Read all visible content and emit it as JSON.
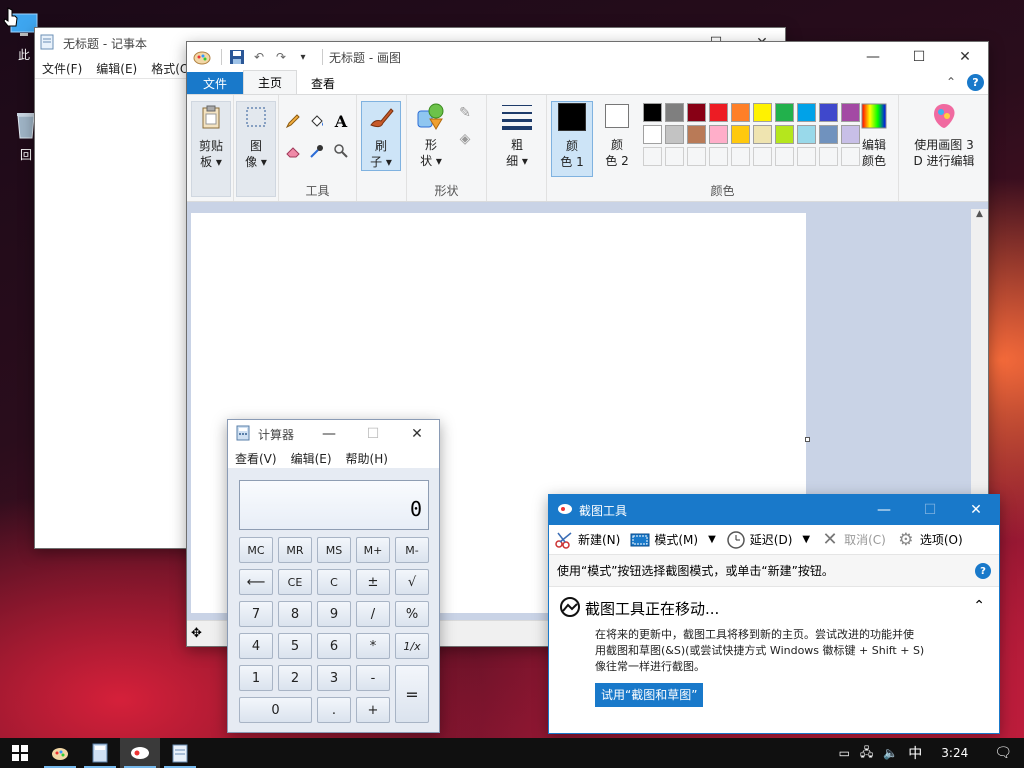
{
  "desktop": {
    "icons": [
      {
        "label": "此"
      },
      {
        "label": "回"
      }
    ]
  },
  "notepad": {
    "title": "无标题 - 记事本",
    "menu": [
      "文件(F)",
      "编辑(E)",
      "格式(O)"
    ]
  },
  "paint": {
    "title": "无标题 - 画图",
    "tabs": {
      "file": "文件",
      "home": "主页",
      "view": "查看"
    },
    "groups": {
      "clipboard": "剪贴板",
      "image": "图像",
      "tools": "工具",
      "brushes": "刷子",
      "shapes": "形状",
      "size": "粗细",
      "color1": "颜色 1",
      "color2": "颜色 2",
      "colors": "颜色",
      "edit_colors": "编辑颜色",
      "paint3d": "使用画图 3D 进行编辑"
    },
    "labels": {
      "clipboard_a": "剪贴",
      "clipboard_b": "板",
      "image_a": "图",
      "image_b": "像",
      "brush_a": "刷",
      "brush_b": "子",
      "shape_a": "形",
      "shape_b": "状",
      "size_a": "粗",
      "size_b": "细",
      "color1_a": "颜",
      "color1_b": "色 1",
      "color2_a": "颜",
      "color2_b": "色 2",
      "edit_a": "编辑",
      "edit_b": "颜色",
      "p3d_a": "使用画图 3",
      "p3d_b": "D 进行编辑"
    },
    "palette_row1": [
      "#000000",
      "#7f7f7f",
      "#880015",
      "#ed1c24",
      "#ff7f27",
      "#fff200",
      "#22b14c",
      "#00a2e8",
      "#3f48cc",
      "#a349a4"
    ],
    "palette_row2": [
      "#ffffff",
      "#c3c3c3",
      "#b97a57",
      "#ffaec9",
      "#ffc90e",
      "#efe4b0",
      "#b5e61d",
      "#99d9ea",
      "#7092be",
      "#c8bfe7"
    ],
    "color1": "#000000",
    "color2": "#ffffff"
  },
  "calculator": {
    "title": "计算器",
    "menu": [
      "查看(V)",
      "编辑(E)",
      "帮助(H)"
    ],
    "display": "0",
    "buttons": {
      "mc": "MC",
      "mr": "MR",
      "ms": "MS",
      "mplus": "M+",
      "mminus": "M-",
      "back": "⟵",
      "ce": "CE",
      "c": "C",
      "pm": "±",
      "sqrt": "√",
      "n7": "7",
      "n8": "8",
      "n9": "9",
      "div": "/",
      "pct": "%",
      "n4": "4",
      "n5": "5",
      "n6": "6",
      "mul": "*",
      "inv": "1/x",
      "n1": "1",
      "n2": "2",
      "n3": "3",
      "sub": "-",
      "eq": "=",
      "n0": "0",
      "dot": ".",
      "add": "+"
    }
  },
  "snip": {
    "title": "截图工具",
    "toolbar": {
      "new": "新建(N)",
      "mode": "模式(M)",
      "delay": "延迟(D)",
      "cancel": "取消(C)",
      "options": "选项(O)"
    },
    "hint": "使用“模式”按钮选择截图模式，或单击“新建”按钮。",
    "moving_title": "截图工具正在移动...",
    "moving_line1": "在将来的更新中，截图工具将移到新的主页。尝试改进的功能并使",
    "moving_line2": "用截图和草图(&S)(或尝试快捷方式 Windows 徽标键 + Shift + S)",
    "moving_line3": "像往常一样进行截图。",
    "try_button": "试用“截图和草图”"
  },
  "taskbar": {
    "time": "3:24",
    "ime": "中"
  }
}
